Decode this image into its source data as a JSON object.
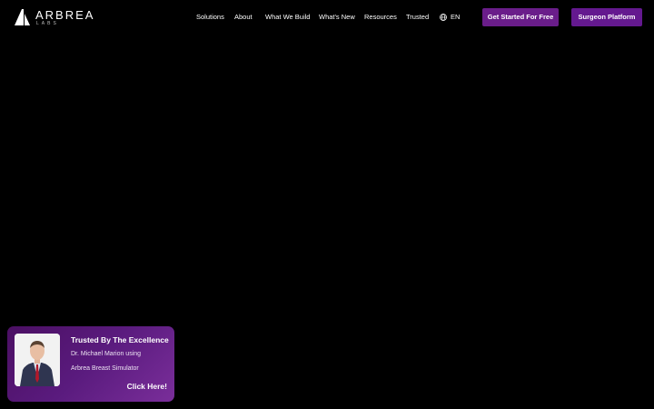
{
  "brand": {
    "name": "ARBREA",
    "tagline": "LABS"
  },
  "nav": {
    "items": [
      {
        "label": "Solutions"
      },
      {
        "label": "About"
      },
      {
        "label": "What We Build"
      },
      {
        "label": "What's New"
      },
      {
        "label": "Resources"
      },
      {
        "label": "Trusted"
      }
    ],
    "language": "EN"
  },
  "buttons": {
    "get_started": "Get Started For Free",
    "surgeon_platform": "Surgeon Platform"
  },
  "promo": {
    "title": "Trusted By The Excellence",
    "line1": "Dr. Michael Marion using",
    "line2": "Arbrea Breast Simulator",
    "cta": "Click Here!"
  },
  "colors": {
    "background": "#000000",
    "primary_button": "#6a1d8a",
    "secondary_button": "#64198f",
    "promo_gradient_start": "#4b0f63",
    "promo_gradient_end": "#7a2e9a"
  }
}
